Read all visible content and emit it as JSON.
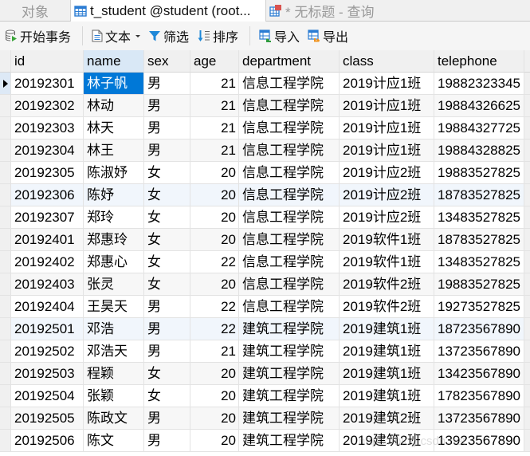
{
  "tabs": {
    "objects": "对象",
    "active": "t_student @student (root...",
    "query": "* 无标题 - 查询"
  },
  "toolbar": {
    "begin_transaction": "开始事务",
    "text": "文本",
    "filter": "筛选",
    "sort": "排序",
    "import": "导入",
    "export": "导出"
  },
  "colors": {
    "selection": "#0078d7",
    "header_bg": "#f0f0f0",
    "sorted_header_bg": "#d9e8f6",
    "accent_icon": "#2b7cd3"
  },
  "table": {
    "columns": [
      "id",
      "name",
      "sex",
      "age",
      "department",
      "class",
      "telephone"
    ],
    "rows": [
      [
        "20192301",
        "林子帆",
        "男",
        "21",
        "信息工程学院",
        "2019计应1班",
        "19882323345"
      ],
      [
        "20192302",
        "林动",
        "男",
        "21",
        "信息工程学院",
        "2019计应1班",
        "19884326625"
      ],
      [
        "20192303",
        "林天",
        "男",
        "21",
        "信息工程学院",
        "2019计应1班",
        "19884327725"
      ],
      [
        "20192304",
        "林王",
        "男",
        "21",
        "信息工程学院",
        "2019计应1班",
        "19884328825"
      ],
      [
        "20192305",
        "陈淑妤",
        "女",
        "20",
        "信息工程学院",
        "2019计应2班",
        "19883527825"
      ],
      [
        "20192306",
        "陈妤",
        "女",
        "20",
        "信息工程学院",
        "2019计应2班",
        "18783527825"
      ],
      [
        "20192307",
        "郑玲",
        "女",
        "20",
        "信息工程学院",
        "2019计应2班",
        "13483527825"
      ],
      [
        "20192401",
        "郑惠玲",
        "女",
        "20",
        "信息工程学院",
        "2019软件1班",
        "18783527825"
      ],
      [
        "20192402",
        "郑惠心",
        "女",
        "22",
        "信息工程学院",
        "2019软件1班",
        "13483527825"
      ],
      [
        "20192403",
        "张灵",
        "女",
        "20",
        "信息工程学院",
        "2019软件2班",
        "19883527825"
      ],
      [
        "20192404",
        "王昊天",
        "男",
        "22",
        "信息工程学院",
        "2019软件2班",
        "19273527825"
      ],
      [
        "20192501",
        "邓浩",
        "男",
        "22",
        "建筑工程学院",
        "2019建筑1班",
        "18723567890"
      ],
      [
        "20192502",
        "邓浩天",
        "男",
        "21",
        "建筑工程学院",
        "2019建筑1班",
        "13723567890"
      ],
      [
        "20192503",
        "程颖",
        "女",
        "20",
        "建筑工程学院",
        "2019建筑1班",
        "13423567890"
      ],
      [
        "20192504",
        "张颖",
        "女",
        "20",
        "建筑工程学院",
        "2019建筑1班",
        "17823567890"
      ],
      [
        "20192505",
        "陈政文",
        "男",
        "20",
        "建筑工程学院",
        "2019建筑2班",
        "13723567890"
      ],
      [
        "20192506",
        "陈文",
        "男",
        "20",
        "建筑工程学院",
        "2019建筑2班",
        "13923567890"
      ]
    ],
    "selected_cell": {
      "row": 0,
      "column": "name"
    },
    "current_row": 0
  },
  "watermark": "https://blog.csdn.net"
}
